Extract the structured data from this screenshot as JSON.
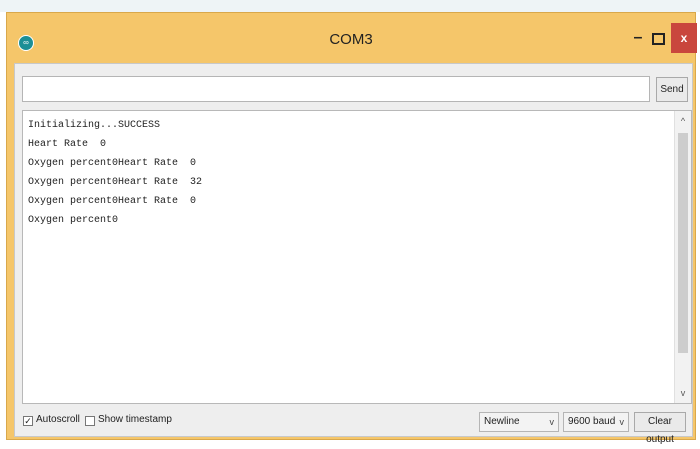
{
  "window": {
    "title": "COM3",
    "icon_text": "∞",
    "minimize_glyph": "–",
    "close_glyph": "x"
  },
  "input": {
    "value": "",
    "send_label": "Send"
  },
  "output": {
    "lines": [
      "Initializing...SUCCESS",
      "Heart Rate  0",
      "Oxygen percent0Heart Rate  0",
      "Oxygen percent0Heart Rate  32",
      "Oxygen percent0Heart Rate  0",
      "Oxygen percent0"
    ]
  },
  "scrollbar": {
    "up_glyph": "^",
    "down_glyph": "v"
  },
  "bottom": {
    "autoscroll_label": "Autoscroll",
    "autoscroll_checked": "✓",
    "timestamp_label": "Show timestamp",
    "line_ending": "Newline",
    "baud": "9600 baud",
    "dropdown_glyph": "v",
    "clear_label": "Clear output"
  },
  "colors": {
    "title_bar": "#f5c66a",
    "close_button": "#c9463d",
    "icon": "#1c8f96"
  }
}
